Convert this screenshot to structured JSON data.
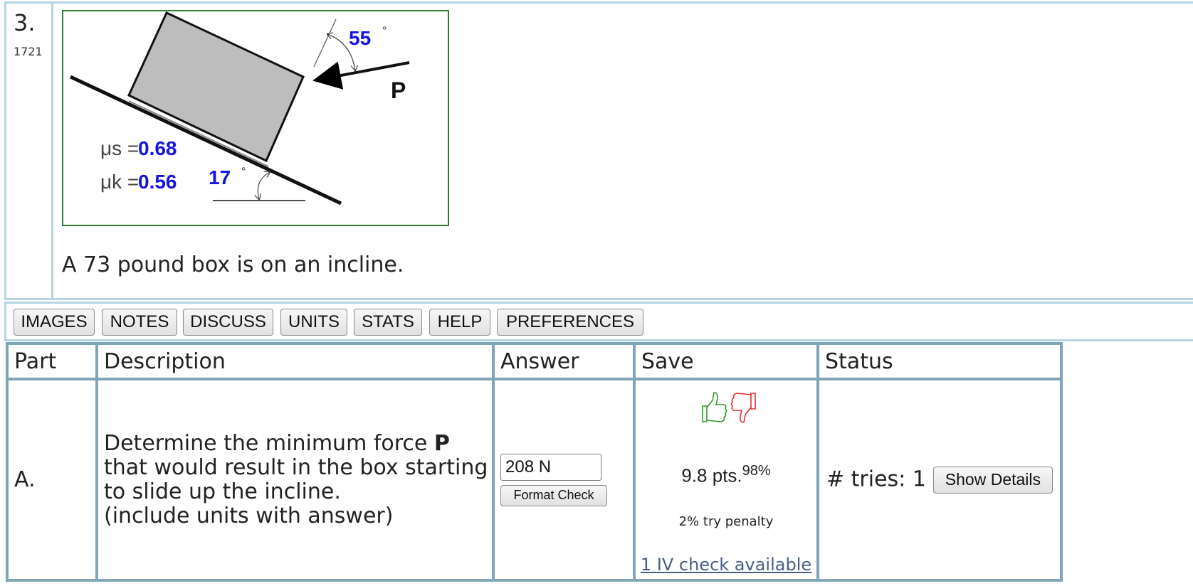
{
  "problem": {
    "number": "3.",
    "id": "1721",
    "text": "A 73 pound box is on an incline.",
    "figure": {
      "angle_p_value": "55",
      "angle_p_unit": "°",
      "p_label": "P",
      "mu_s_symbol": "μs =",
      "mu_s_value": "0.68",
      "mu_k_symbol": "μk =",
      "mu_k_value": "0.56",
      "incline_angle_value": "17",
      "incline_angle_unit": "°",
      "colors": {
        "value_blue": "#1414e0",
        "box_fill": "#bdbdbd",
        "frame_green": "#2f7d2f"
      }
    }
  },
  "toolbar": {
    "buttons": [
      "IMAGES",
      "NOTES",
      "DISCUSS",
      "UNITS",
      "STATS",
      "HELP",
      "PREFERENCES"
    ]
  },
  "table": {
    "headers": {
      "part": "Part",
      "description": "Description",
      "answer": "Answer",
      "save": "Save",
      "status": "Status"
    },
    "rows": [
      {
        "part": "A.",
        "desc_pre": "Determine the minimum force ",
        "desc_bold": "P",
        "desc_post": " that would result in the box starting to slide up the incline.",
        "desc_note": "(include units with answer)",
        "answer_value": "208 N",
        "format_check_label": "Format Check",
        "points": "9.8 pts.",
        "percent": "98%",
        "penalty": "2% try penalty",
        "iv_check": "1 IV check available",
        "tries": "# tries: 1",
        "show_details_label": "Show Details"
      }
    ]
  }
}
